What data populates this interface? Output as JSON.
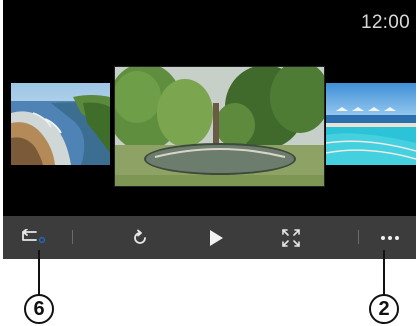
{
  "status_bar": {
    "time": "12:00"
  },
  "gallery": {
    "photos": [
      {
        "name": "coastline-photo"
      },
      {
        "name": "park-pond-photo"
      },
      {
        "name": "pool-resort-photo"
      }
    ]
  },
  "toolbar": {
    "buttons": [
      {
        "icon": "back-icon"
      },
      {
        "icon": "rotate-icon"
      },
      {
        "icon": "play-icon"
      },
      {
        "icon": "fullscreen-icon"
      },
      {
        "icon": "more-icon"
      }
    ]
  },
  "callouts": {
    "back_label": "6",
    "more_label": "2"
  },
  "colors": {
    "screen": "#000000",
    "toolbar": "#3c3c3c",
    "icon": "#e6e6e6",
    "accent": "#1f6fd1"
  }
}
